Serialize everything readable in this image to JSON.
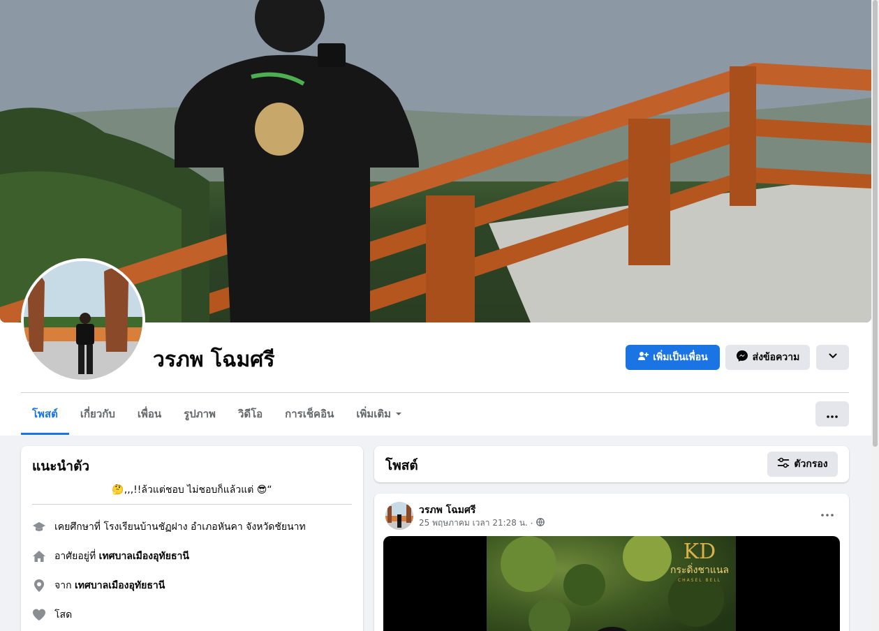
{
  "profile": {
    "name": "วรภพ โฉมศรี"
  },
  "actions": {
    "add_friend": "เพิ่มเป็นเพื่อน",
    "message": "ส่งข้อความ"
  },
  "tabs": [
    {
      "label": "โพสต์",
      "active": true
    },
    {
      "label": "เกี่ยวกับ"
    },
    {
      "label": "เพื่อน"
    },
    {
      "label": "รูปภาพ"
    },
    {
      "label": "วิดีโอ"
    },
    {
      "label": "การเช็คอิน"
    },
    {
      "label": "เพิ่มเติม"
    }
  ],
  "intro": {
    "title": "แนะนำตัว",
    "bio": "🤔,,,!!ล้วแต่ชอบ ไม่ชอบก็แล้วแต่ 😎“",
    "items": [
      {
        "icon": "graduation-cap-icon",
        "prefix": "เคยศึกษาที่ โรงเรียนบ้านชัฏฝาง อำเภอหันคา จังหวัดชัยนาท",
        "bold": ""
      },
      {
        "icon": "home-icon",
        "prefix": "อาศัยอยู่ที่ ",
        "bold": "เทศบาลเมืองอุทัยธานี"
      },
      {
        "icon": "location-pin-icon",
        "prefix": "จาก ",
        "bold": "เทศบาลเมืองอุทัยธานี"
      },
      {
        "icon": "heart-icon",
        "prefix": "โสด",
        "bold": ""
      }
    ]
  },
  "posts": {
    "title": "โพสต์",
    "filter_label": "ตัวกรอง"
  },
  "post": {
    "author": "วรภพ โฉมศรี",
    "timestamp": "25 พฤษภาคม เวลา 21:28 น.",
    "separator": "·",
    "logo_main": "KD",
    "logo_sub": "กระดิ่งชาแนล",
    "logo_tiny": "CHASEL BELL"
  },
  "colors": {
    "accent": "#1b74e4",
    "secondary_button": "#e4e6eb",
    "page_background": "#f0f2f5"
  }
}
